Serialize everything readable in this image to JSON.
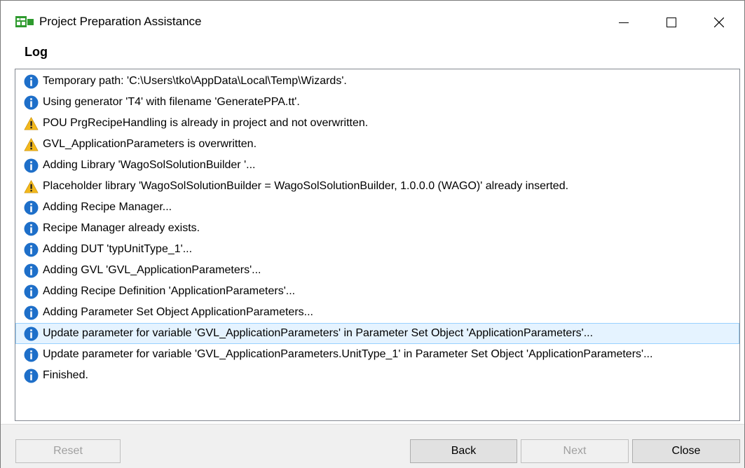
{
  "window": {
    "title": "Project Preparation Assistance",
    "minimize_icon": "minimize-icon",
    "maximize_icon": "maximize-icon",
    "close_icon": "close-icon"
  },
  "section": {
    "heading": "Log"
  },
  "log": {
    "entries": [
      {
        "type": "info",
        "icon": "info-icon",
        "text": "Temporary path: 'C:\\Users\\tko\\AppData\\Local\\Temp\\Wizards'."
      },
      {
        "type": "info",
        "icon": "info-icon",
        "text": "Using generator 'T4' with filename 'GeneratePPA.tt'."
      },
      {
        "type": "warning",
        "icon": "warning-icon",
        "text": "POU PrgRecipeHandling is already in project and not overwritten."
      },
      {
        "type": "warning",
        "icon": "warning-icon",
        "text": "GVL_ApplicationParameters is overwritten."
      },
      {
        "type": "info",
        "icon": "info-icon",
        "text": "Adding Library 'WagoSolSolutionBuilder '..."
      },
      {
        "type": "warning",
        "icon": "warning-icon",
        "text": "Placeholder library 'WagoSolSolutionBuilder = WagoSolSolutionBuilder, 1.0.0.0 (WAGO)' already inserted."
      },
      {
        "type": "info",
        "icon": "info-icon",
        "text": "Adding Recipe Manager..."
      },
      {
        "type": "info",
        "icon": "info-icon",
        "text": "Recipe Manager already exists."
      },
      {
        "type": "info",
        "icon": "info-icon",
        "text": "Adding DUT 'typUnitType_1'..."
      },
      {
        "type": "info",
        "icon": "info-icon",
        "text": "Adding GVL 'GVL_ApplicationParameters'..."
      },
      {
        "type": "info",
        "icon": "info-icon",
        "text": "Adding Recipe Definition 'ApplicationParameters'..."
      },
      {
        "type": "info",
        "icon": "info-icon",
        "text": "Adding Parameter Set Object ApplicationParameters..."
      },
      {
        "type": "info",
        "icon": "info-icon",
        "text": "Update parameter for variable 'GVL_ApplicationParameters' in Parameter Set Object 'ApplicationParameters'...",
        "selected": true
      },
      {
        "type": "info",
        "icon": "info-icon",
        "text": "Update parameter for variable 'GVL_ApplicationParameters.UnitType_1' in Parameter Set Object 'ApplicationParameters'..."
      },
      {
        "type": "info",
        "icon": "info-icon",
        "text": "Finished."
      }
    ]
  },
  "buttons": {
    "reset": {
      "label": "Reset",
      "enabled": false
    },
    "back": {
      "label": "Back",
      "enabled": true
    },
    "next": {
      "label": "Next",
      "enabled": false
    },
    "close": {
      "label": "Close",
      "enabled": true
    }
  },
  "colors": {
    "info_icon": "#1e6fc9",
    "warning_icon": "#f2b81c",
    "selection_bg": "#e5f3ff",
    "selection_border": "#99d1ff",
    "app_icon": "#2e9a2e"
  }
}
